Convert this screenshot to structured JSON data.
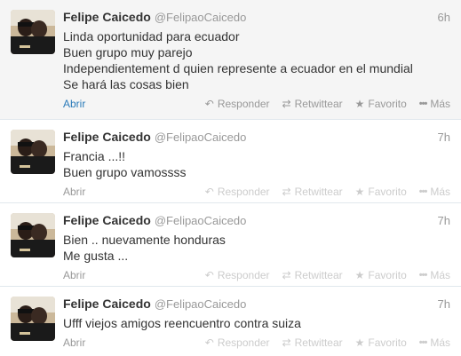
{
  "tweets": [
    {
      "fullname": "Felipe Caicedo",
      "username": "@FelipaoCaicedo",
      "time": "6h",
      "lines": [
        "Linda oportunidad para ecuador",
        "Buen grupo muy parejo",
        "Independientement d quien represente a ecuador en el mundial",
        "Se hará las cosas bien"
      ],
      "expand_label": "Abrir",
      "reply_label": "Responder",
      "retweet_label": "Retwittear",
      "favorite_label": "Favorito",
      "more_label": "Más"
    },
    {
      "fullname": "Felipe Caicedo",
      "username": "@FelipaoCaicedo",
      "time": "7h",
      "lines": [
        "Francia ...!!",
        "Buen grupo vamossss"
      ],
      "expand_label": "Abrir",
      "reply_label": "Responder",
      "retweet_label": "Retwittear",
      "favorite_label": "Favorito",
      "more_label": "Más"
    },
    {
      "fullname": "Felipe Caicedo",
      "username": "@FelipaoCaicedo",
      "time": "7h",
      "lines": [
        "Bien .. nuevamente honduras",
        "Me gusta ..."
      ],
      "expand_label": "Abrir",
      "reply_label": "Responder",
      "retweet_label": "Retwittear",
      "favorite_label": "Favorito",
      "more_label": "Más"
    },
    {
      "fullname": "Felipe Caicedo",
      "username": "@FelipaoCaicedo",
      "time": "7h",
      "lines": [
        "Ufff viejos amigos reencuentro contra suiza"
      ],
      "expand_label": "Abrir",
      "reply_label": "Responder",
      "retweet_label": "Retwittear",
      "favorite_label": "Favorito",
      "more_label": "Más"
    }
  ],
  "icons": {
    "reply": "reply-icon",
    "retweet": "retweet-icon",
    "favorite": "star-icon",
    "more": "more-dots-icon"
  },
  "colors": {
    "link": "#2b7bb9",
    "text": "#333333",
    "muted": "#999999",
    "border": "#e1e8ed"
  }
}
